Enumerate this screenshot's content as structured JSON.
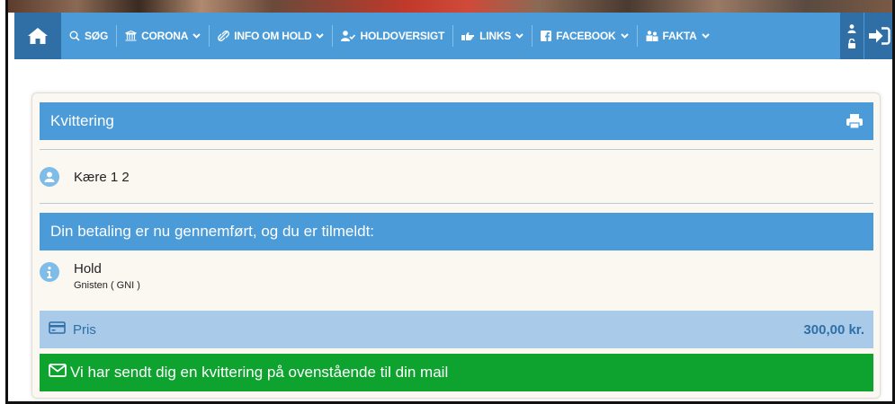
{
  "nav": {
    "items": [
      {
        "label": "SØG",
        "icon": "search-icon",
        "has_dropdown": false
      },
      {
        "label": "CORONA",
        "icon": "building-icon",
        "has_dropdown": true
      },
      {
        "label": "INFO OM HOLD",
        "icon": "link-icon",
        "has_dropdown": true
      },
      {
        "label": "HOLDOVERSIGT",
        "icon": "user-check-icon",
        "has_dropdown": false
      },
      {
        "label": "LINKS",
        "icon": "hand-pointer-icon",
        "has_dropdown": true
      },
      {
        "label": "FACEBOOK",
        "icon": "facebook-icon",
        "has_dropdown": true
      },
      {
        "label": "FAKTA",
        "icon": "users-icon",
        "has_dropdown": true
      }
    ]
  },
  "receipt": {
    "title": "Kvittering",
    "greeting": "Kære 1 2",
    "confirmation": "Din betaling er nu gennemført, og du er tilmeldt:",
    "hold_label": "Hold",
    "hold_value": "Gnisten ( GNI )",
    "price_label": "Pris",
    "price_value": "300,00 kr.",
    "mail_message": "Vi har sendt dig en kvittering på ovenstående til din mail"
  },
  "colors": {
    "nav_bg": "#4a9bd8",
    "nav_dark": "#2f6fa6",
    "header_bar": "#4a9bd8",
    "price_bar": "#a9cbe9",
    "success_bar": "#0ea32f",
    "card_bg": "#fbf8f1"
  }
}
